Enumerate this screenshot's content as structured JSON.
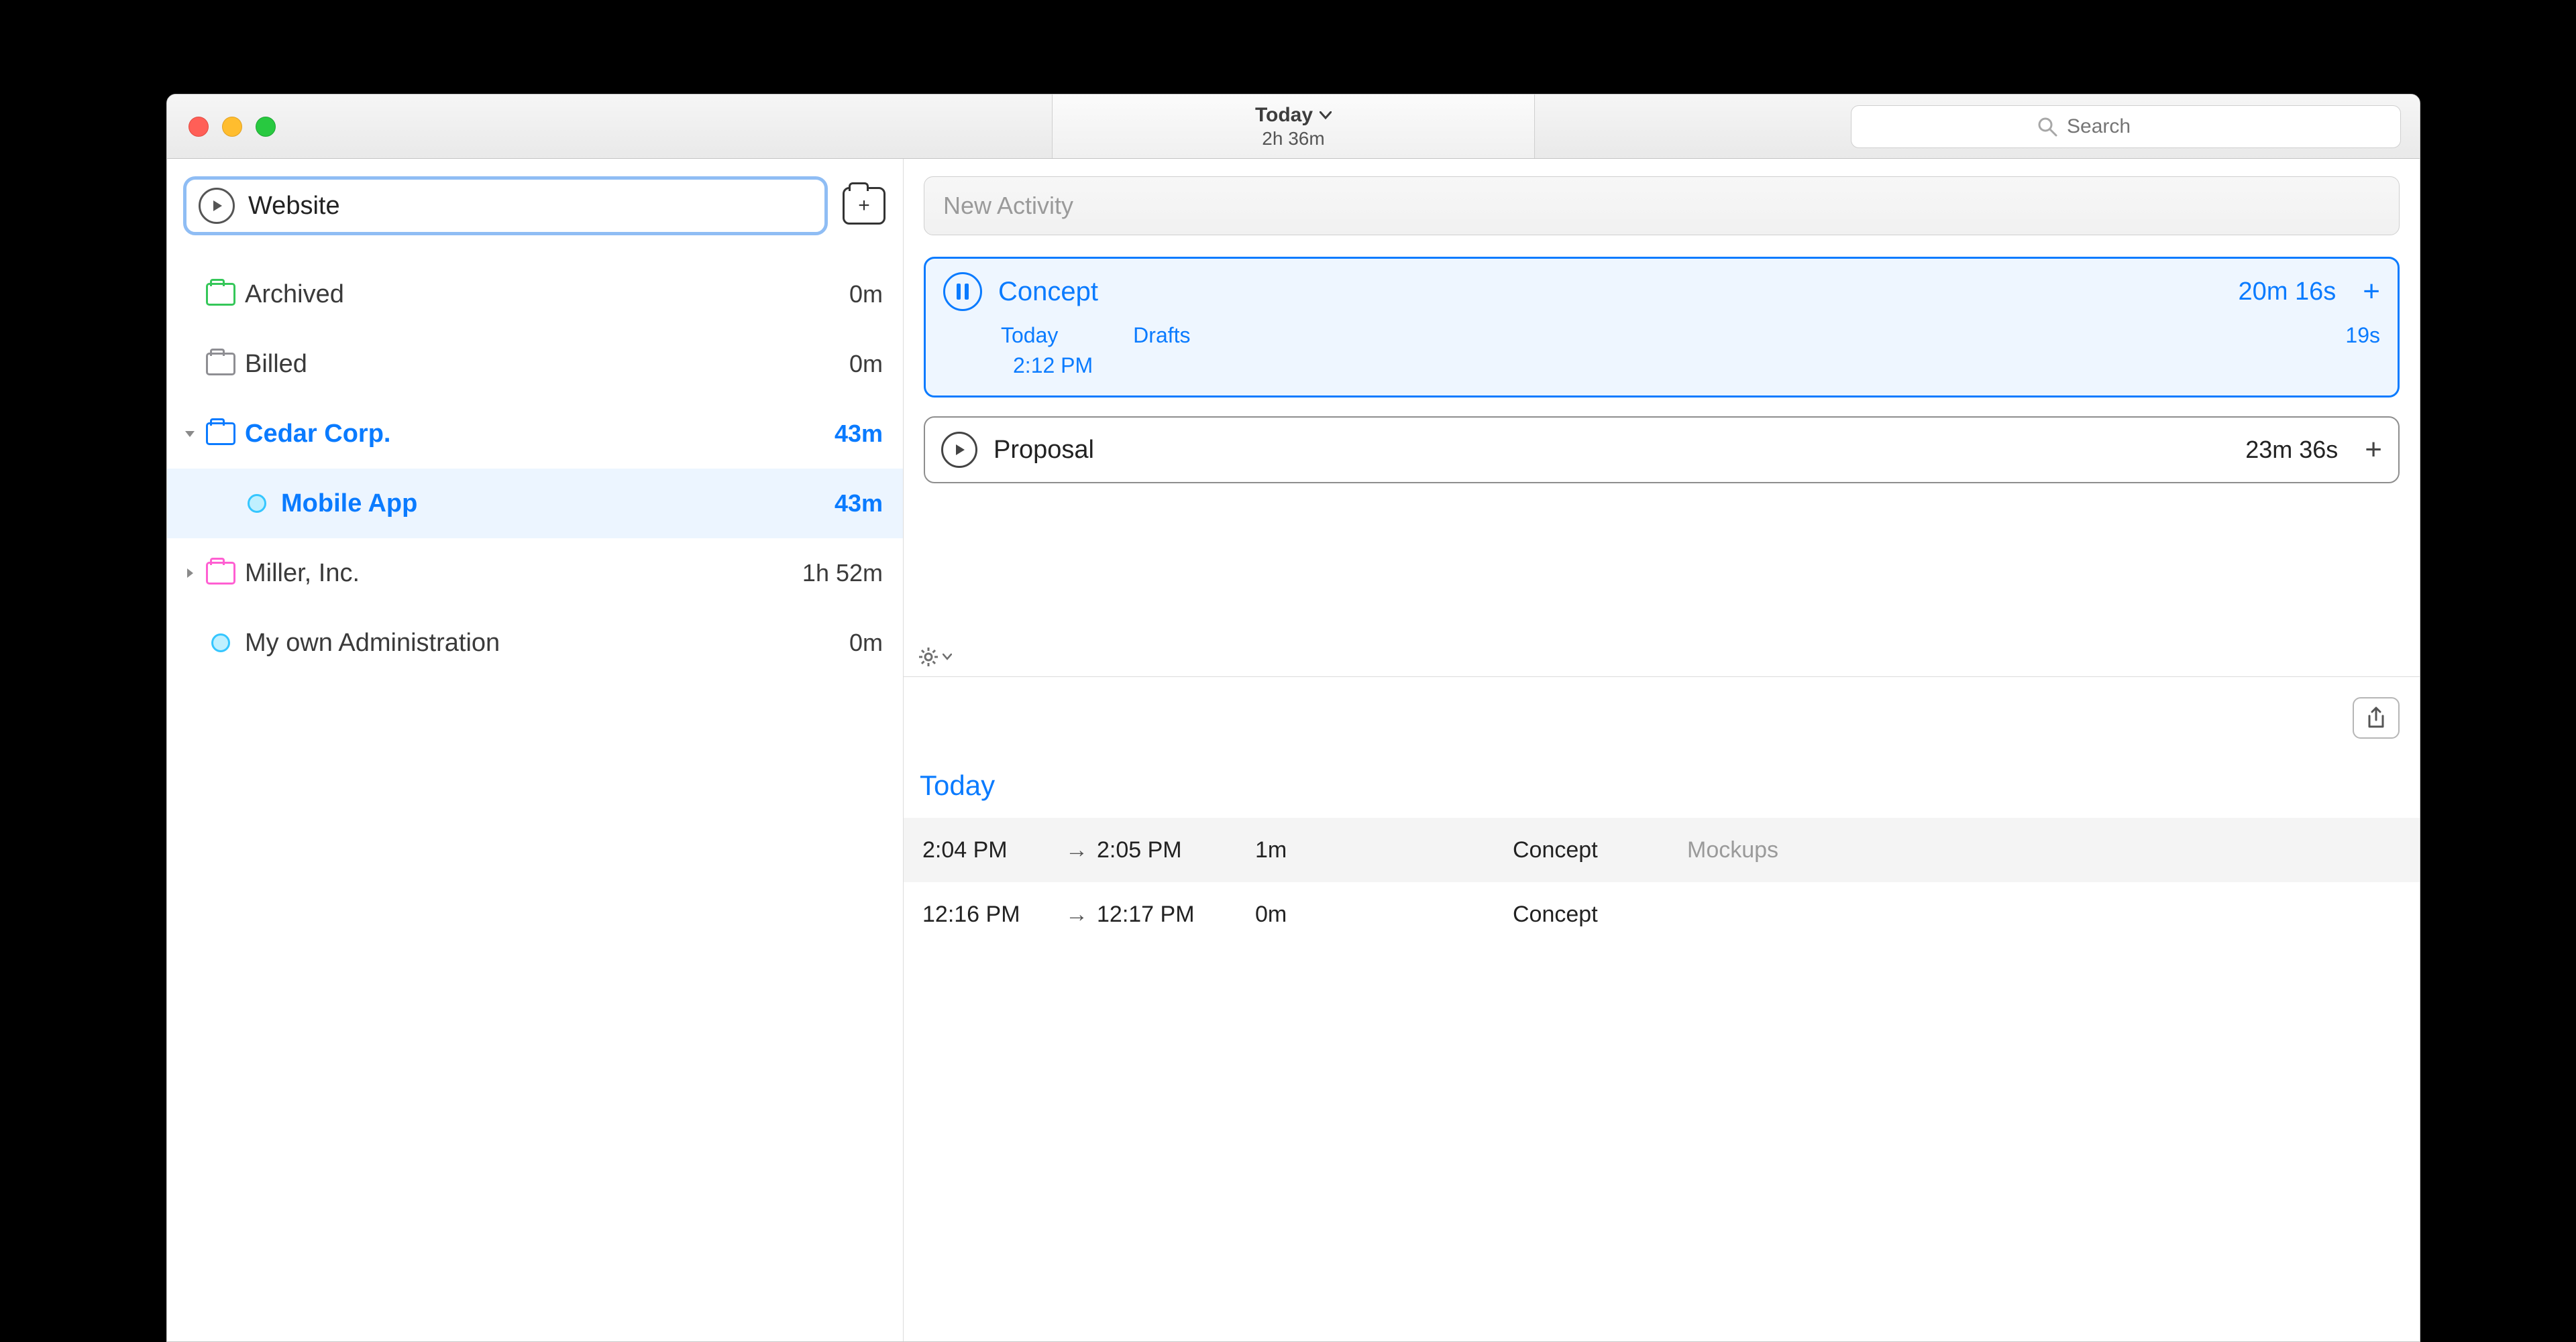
{
  "titlebar": {
    "date_label": "Today",
    "total": "2h 36m",
    "search_placeholder": "Search"
  },
  "sidebar": {
    "input_value": "Website",
    "items": [
      {
        "kind": "folder",
        "color": "green",
        "label": "Archived",
        "time": "0m"
      },
      {
        "kind": "folder",
        "color": "grey",
        "label": "Billed",
        "time": "0m"
      },
      {
        "kind": "folder",
        "color": "blue",
        "label": "Cedar Corp.",
        "time": "43m",
        "expanded": true,
        "bold": true
      },
      {
        "kind": "dot",
        "label": "Mobile App",
        "time": "43m",
        "bold": true,
        "selected": true,
        "level": 2
      },
      {
        "kind": "folder",
        "color": "pink",
        "label": "Miller, Inc.",
        "time": "1h 52m",
        "expanded": false
      },
      {
        "kind": "dot",
        "label": "My own Administration",
        "time": "0m"
      }
    ]
  },
  "main": {
    "new_activity_placeholder": "New Activity",
    "concept": {
      "title": "Concept",
      "duration": "20m 16s",
      "sub_day": "Today",
      "sub_time": "2:12 PM",
      "sub_tag": "Drafts",
      "sub_dur": "19s"
    },
    "proposal": {
      "title": "Proposal",
      "duration": "23m 36s"
    },
    "log": {
      "section": "Today",
      "rows": [
        {
          "from": "2:04 PM",
          "to": "2:05 PM",
          "dur": "1m",
          "name": "Concept",
          "note": "Mockups"
        },
        {
          "from": "12:16 PM",
          "to": "12:17 PM",
          "dur": "0m",
          "name": "Concept",
          "note": ""
        }
      ]
    }
  }
}
